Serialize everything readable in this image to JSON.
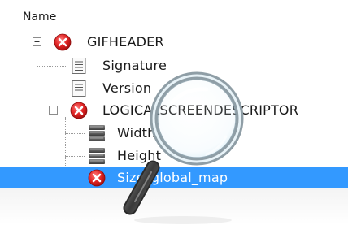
{
  "header": {
    "column_name": "Name"
  },
  "tree": {
    "nodes": [
      {
        "label": "GIFHEADER",
        "icon": "error-icon",
        "expander": "minus"
      },
      {
        "label": "Signature",
        "icon": "document-icon"
      },
      {
        "label": "Version",
        "icon": "document-icon"
      },
      {
        "label": "LOGICALSCREENDESCRIPTOR",
        "icon": "error-icon",
        "expander": "minus"
      },
      {
        "label": "Width",
        "icon": "data-stack-icon"
      },
      {
        "label": "Height",
        "icon": "data-stack-icon"
      },
      {
        "label": "Size_global_map",
        "icon": "error-icon",
        "selected": true
      }
    ]
  },
  "overlay": {
    "icon": "magnifying-glass-icon"
  },
  "colors": {
    "selection": "#3399ff",
    "error": "#d81e1e"
  }
}
